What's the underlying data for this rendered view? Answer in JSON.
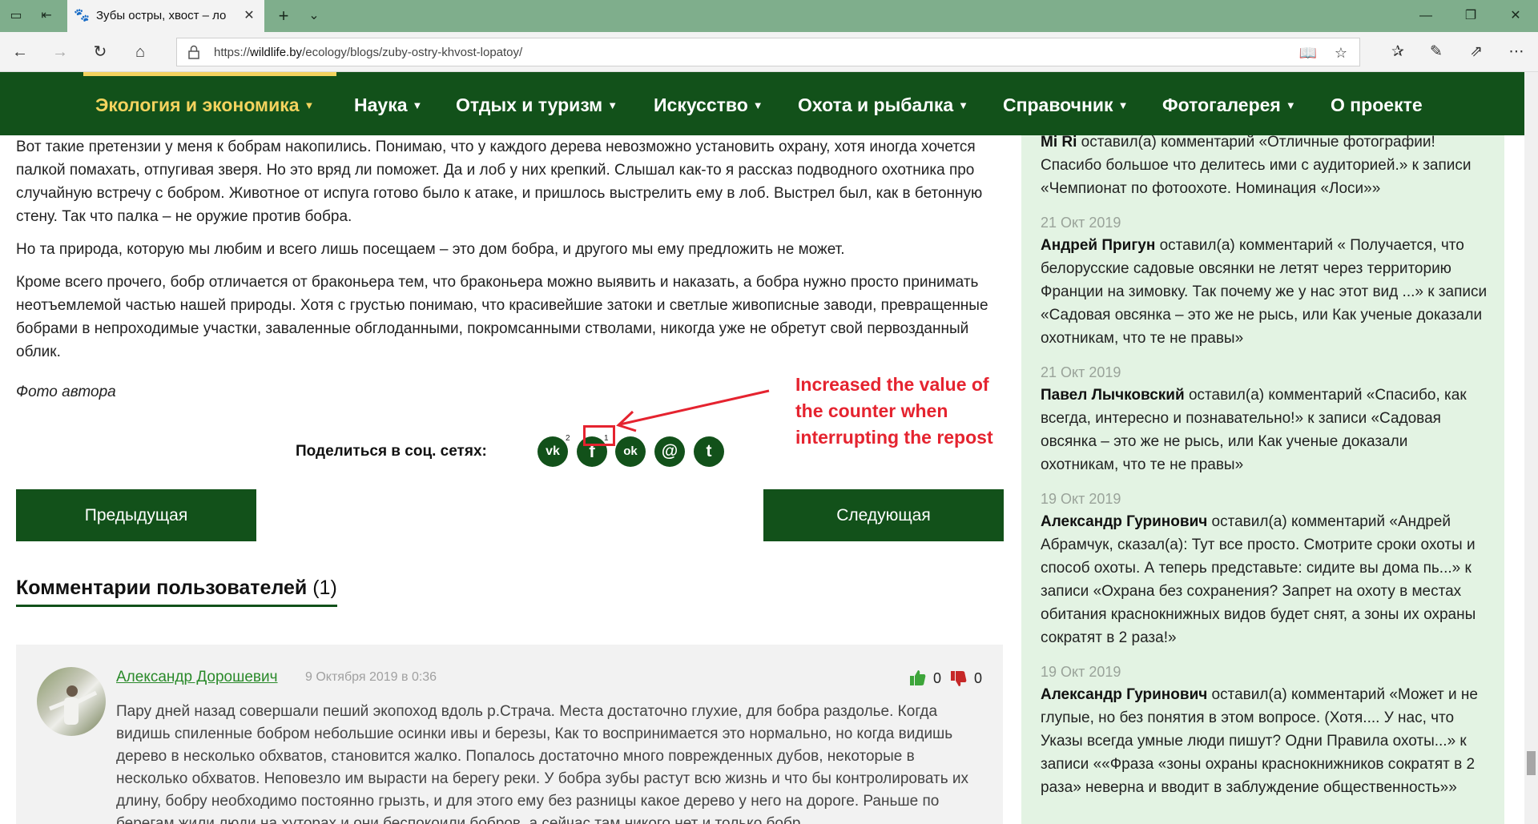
{
  "browser": {
    "tab_title": "Зубы остры, хвост – ло",
    "url_prefix": "https://",
    "url_host": "wildlife.by",
    "url_path": "/ecology/blogs/zuby-ostry-khvost-lopatoy/"
  },
  "nav": {
    "items": [
      {
        "label": "Экология и экономика"
      },
      {
        "label": "Наука"
      },
      {
        "label": "Отдых и туризм"
      },
      {
        "label": "Искусство"
      },
      {
        "label": "Охота и рыбалка"
      },
      {
        "label": "Справочник"
      },
      {
        "label": "Фотогалерея"
      },
      {
        "label": "О проекте"
      }
    ]
  },
  "article": {
    "paragraphs": [
      "Вот такие претензии у меня к бобрам накопились. Понимаю, что у каждого дерева невозможно установить охрану, хотя иногда хочется палкой помахать, отпугивая зверя. Но это вряд ли поможет.  Да и лоб у них крепкий. Слышал как-то я рассказ подводного охотника про случайную встречу с бобром.  Животное от испуга готово было к атаке, и пришлось выстрелить ему в лоб. Выстрел был, как в бетонную стену. Так что палка – не оружие против бобра.",
      "Но та природа, которую мы любим и всего лишь посещаем – это дом бобра, и другого мы ему предложить не может.",
      "Кроме всего прочего, бобр отличается от браконьера тем, что браконьера можно выявить и наказать, а бобра нужно просто принимать неотъемлемой частью нашей природы. Хотя с грустью понимаю, что красивейшие затоки и светлые живописные  заводи, превращенные бобрами в непроходимые участки, заваленные обглоданными, покромсанными стволами, никогда уже не обретут свой первозданный облик."
    ],
    "photo_credit": "Фото автора"
  },
  "share": {
    "label": "Поделиться в соц. сетях:",
    "buttons": [
      {
        "icon": "vk-icon",
        "glyph": "vk",
        "count": "2"
      },
      {
        "icon": "facebook-icon",
        "glyph": "f",
        "count": "1"
      },
      {
        "icon": "odnoklassniki-icon",
        "glyph": "ok",
        "count": ""
      },
      {
        "icon": "mail-icon",
        "glyph": "@",
        "count": ""
      },
      {
        "icon": "twitter-icon",
        "glyph": "t",
        "count": ""
      }
    ]
  },
  "annotation": {
    "text_lines": [
      "Increased the value of",
      "the counter when",
      "interrupting the repost"
    ],
    "color": "#e5232f"
  },
  "pager": {
    "prev": "Предыдущая",
    "next": "Следующая"
  },
  "comments": {
    "title": "Комментарии пользователей",
    "count": "(1)",
    "items": [
      {
        "author": "Александр Дорошевич",
        "date": "9 Октября 2019 в 0:36",
        "likes": "0",
        "dislikes": "0",
        "text": "Пару дней назад совершали пеший экопоход вдоль р.Страча. Места достаточно глухие, для бобра раздолье. Когда видишь спиленные бобром небольшие осинки ивы и березы, Как то воспринимается это нормально, но когда видишь дерево в несколько обхватов, становится жалко. Попалось достаточно много поврежденных дубов, некоторые в несколько обхватов. Неповезло им вырасти на берегу реки. У бобра зубы растут всю жизнь и что бы контролировать их длину, бобру необходимо постоянно грызть, и для этого ему без разницы какое дерево у него на дороге. Раньше по берегам жили люди на хуторах и они беспокоили бобров, а сейчас там никого нет и только бобр"
      }
    ]
  },
  "sidebar": {
    "entries": [
      {
        "date": "",
        "name": "Mi Ri",
        "text": " оставил(а) комментарий «Отличные фотографии! Спасибо большое что делитесь ими с аудиторией.» к записи «Чемпионат по фотоохоте. Номинация «Лоси»»"
      },
      {
        "date": "21 Окт 2019",
        "name": "Андрей Пригун",
        "text": " оставил(а) комментарий « Получается, что белорусские садовые овсянки не летят через территорию Франции на зимовку. Так почему же у нас этот вид ...» к записи «Садовая овсянка – это же не рысь, или Как ученые доказали охотникам, что те не правы»"
      },
      {
        "date": "21 Окт 2019",
        "name": "Павел Лычковский",
        "text": " оставил(а) комментарий «Спасибо, как всегда, интересно и познавательно!» к записи «Садовая овсянка – это же не рысь, или Как ученые доказали охотникам, что те не правы»"
      },
      {
        "date": "19 Окт 2019",
        "name": "Александр Гуринович",
        "text": " оставил(а) комментарий «Андрей Абрамчук, сказал(а): Тут все просто. Смотрите сроки охоты и способ охоты. А теперь представьте: сидите вы дома пь...» к записи «Охрана без сохранения? Запрет на охоту в местах обитания краснокнижных видов будет снят, а зоны их охраны сократят в 2 раза!»"
      },
      {
        "date": "19 Окт 2019",
        "name": "Александр Гуринович",
        "text": " оставил(а) комментарий «Может и не глупые, но без понятия в этом вопросе. (Хотя.... У нас, что Указы всегда умные люди пишут? Одни Правила охоты...» к записи ««Фраза «зоны охраны краснокнижников сократят в 2 раза» неверна и вводит в заблуждение общественность»»"
      }
    ]
  }
}
